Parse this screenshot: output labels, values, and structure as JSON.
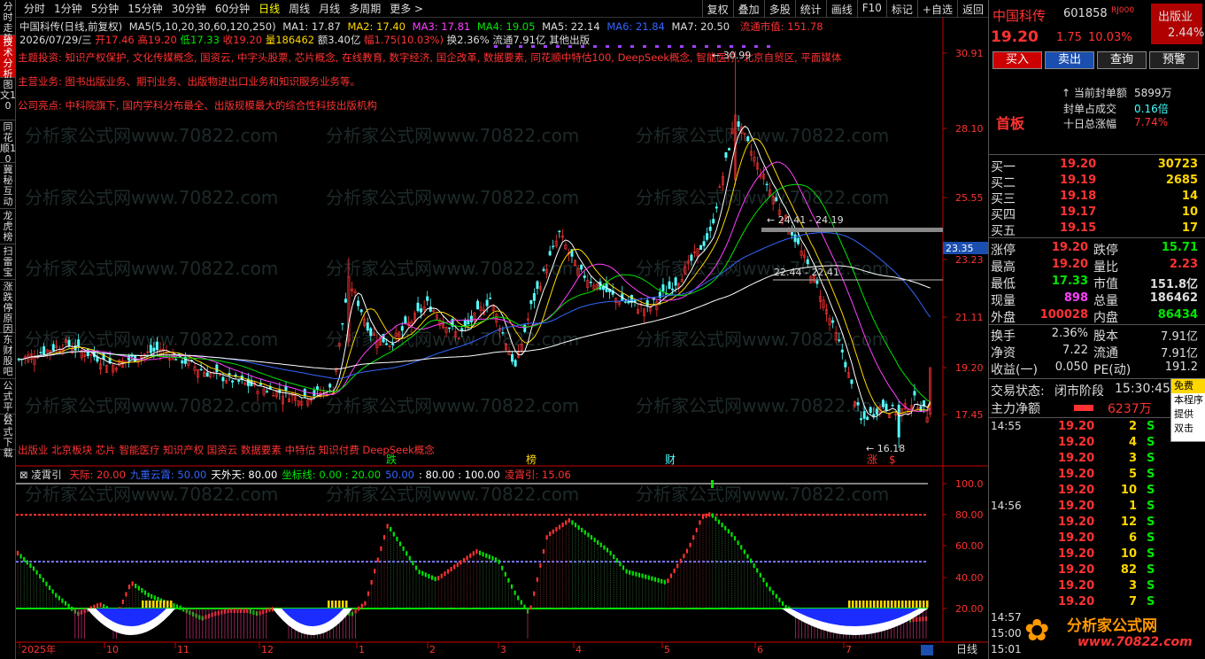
{
  "left_tabs": [
    "分时走势",
    "技术分析",
    "图文10",
    "同花顺10",
    "冀秘互动",
    "龙虎榜",
    "扫雷宝",
    "涨跌停原因",
    "东财股吧",
    "公式平台",
    "公式下载"
  ],
  "active_left_tab": 1,
  "periods": [
    "分时",
    "1分钟",
    "5分钟",
    "15分钟",
    "30分钟",
    "60分钟",
    "日线",
    "周线",
    "月线",
    "多周期",
    "更多 >"
  ],
  "active_period": 6,
  "toolbar": [
    "复权",
    "叠加",
    "多股",
    "统计",
    "画线",
    "F10",
    "标记",
    "+自选",
    "返回"
  ],
  "title_line": {
    "stock": "中国科传(日线,前复权)",
    "ma_label": "MA5(5,10,20,30,60,120,250)",
    "ma1": "MA1: 17.87",
    "ma2": "MA2: 17.40",
    "ma3": "MA3: 17.81",
    "ma4": "MA4: 19.05",
    "ma5": "MA5: 22.14",
    "ma6": "MA6: 21.84",
    "ma7": "MA7: 20.50",
    "float_cap": "流通市值: 151.78"
  },
  "ohlc_line": {
    "date": "2026/07/29/三",
    "open": "开17.46",
    "high": "高19.20",
    "low": "低17.33",
    "close": "收19.20",
    "vol": "量186462",
    "amt": "额3.40亿",
    "chg": "幅1.75(10.03%)",
    "turnover": "换2.36%",
    "float": "流通7.91亿",
    "sector": "其他出版"
  },
  "notes": [
    {
      "text": "主题投资:  知识产权保护, 文化传媒概念, 国资云, 中字头股票, 芯片概念, 在线教育, 数字经济, 国企改革, 数据要素, 同花顺中特估100, DeepSeek概念, 智能医疗, 北京自贸区, 平面媒体",
      "color": "#ff3232"
    },
    {
      "text": "主营业务:  图书出版业务、期刊业务、出版物进出口业务和知识服务业务等。",
      "color": "#ff3232"
    },
    {
      "text": "公司亮点:  中科院旗下, 国内学科分布最全、出版规模最大的综合性科技出版机构",
      "color": "#ff3232"
    }
  ],
  "concept_line": "出版业 北京板块 芯片 智能医疗 知识产权 国资云 数据要素 中特估 知识付费 DeepSeek概念",
  "watermark": "分析家公式网www.70822.com",
  "price_axis": [
    "30.91",
    "28.10",
    "25.55",
    "23.23",
    "21.11",
    "19.20",
    "17.45"
  ],
  "current_price_tag": "23.35",
  "annotations": {
    "high": "30.99",
    "low": "16.18",
    "level1": "24.41 - 24.19",
    "level2": "22.44 - 22.41"
  },
  "event_markers": [
    "跌",
    "榜",
    "财",
    "涨",
    "$"
  ],
  "indicator": {
    "name": "凌霄引",
    "params": [
      {
        "t": "天际: 20.00",
        "c": "#ff3232"
      },
      {
        "t": "九重云霄: 50.00",
        "c": "#3366ff"
      },
      {
        "t": "天外天: 80.00",
        "c": "#fff"
      },
      {
        "t": "坐标线: 0.00 : 20.00",
        "c": "#00e600"
      },
      {
        "t": "50.00",
        "c": "#3366ff"
      },
      {
        "t": ": 80.00 : 100.00",
        "c": "#fff"
      },
      {
        "t": "凌霄引: 15.06",
        "c": "#ff3232"
      }
    ],
    "axis": [
      "100.0",
      "80.00",
      "60.00",
      "40.00",
      "20.00"
    ]
  },
  "date_axis": [
    "2025年",
    "10",
    "11",
    "12",
    "1",
    "2",
    "3",
    "4",
    "5",
    "6",
    "7"
  ],
  "bottom_right_label": "日线",
  "right_panel": {
    "name": "中国科传",
    "code": "601858",
    "tag": "RJ000",
    "sector": "出版业",
    "sector_chg": "2.44%",
    "price": "19.20",
    "chg": "1.75",
    "pct": "10.03%",
    "buttons": [
      "买入",
      "卖出",
      "查询",
      "预警"
    ],
    "seal_label": "当前封单额",
    "seal_val": "5899万",
    "seal_ratio_label": "封单占成交",
    "seal_ratio_val": "0.16倍",
    "ten_day_label": "十日总涨幅",
    "ten_day_val": "7.74%",
    "board": "首板",
    "bids": [
      [
        "买一",
        "19.20",
        "30723"
      ],
      [
        "买二",
        "19.19",
        "2685"
      ],
      [
        "买三",
        "19.18",
        "14"
      ],
      [
        "买四",
        "19.17",
        "10"
      ],
      [
        "买五",
        "19.15",
        "17"
      ]
    ],
    "stats": [
      [
        "涨停",
        "19.20",
        "跌停",
        "15.71"
      ],
      [
        "最高",
        "19.20",
        "量比",
        "2.23"
      ],
      [
        "最低",
        "17.33",
        "市值",
        "151.8亿"
      ],
      [
        "现量",
        "898",
        "总量",
        "186462"
      ],
      [
        "外盘",
        "100028",
        "内盘",
        "86434"
      ]
    ],
    "stats2": [
      [
        "换手",
        "2.36%",
        "股本",
        "7.91亿"
      ],
      [
        "净资",
        "7.22",
        "流通",
        "7.91亿"
      ],
      [
        "收益(一)",
        "0.050",
        "PE(动)",
        "191.2"
      ]
    ],
    "trade_status_label": "交易状态:",
    "trade_status": "闭市阶段",
    "trade_time": "15:30:45",
    "main_flow_label": "主力净额",
    "main_flow_val": "6237万",
    "ticks": [
      [
        "14:55",
        "19.20",
        "2",
        "S"
      ],
      [
        "",
        "19.20",
        "4",
        "S"
      ],
      [
        "",
        "19.20",
        "3",
        "S"
      ],
      [
        "",
        "19.20",
        "5",
        "S"
      ],
      [
        "",
        "19.20",
        "10",
        "S"
      ],
      [
        "14:56",
        "19.20",
        "1",
        "S"
      ],
      [
        "",
        "19.20",
        "12",
        "S"
      ],
      [
        "",
        "19.20",
        "6",
        "S"
      ],
      [
        "",
        "19.20",
        "10",
        "S"
      ],
      [
        "",
        "19.20",
        "82",
        "S"
      ],
      [
        "",
        "19.20",
        "3",
        "S"
      ],
      [
        "",
        "19.20",
        "7",
        "S"
      ],
      [
        "14:57",
        "",
        " ",
        ""
      ],
      [
        "15:00",
        "",
        "",
        ""
      ],
      [
        "15:01",
        "",
        "",
        ""
      ]
    ],
    "popup": [
      "免费",
      "本程序",
      "提供",
      "双击"
    ],
    "logo_text": "分析家公式网",
    "logo_url": "www.70822.com"
  }
}
